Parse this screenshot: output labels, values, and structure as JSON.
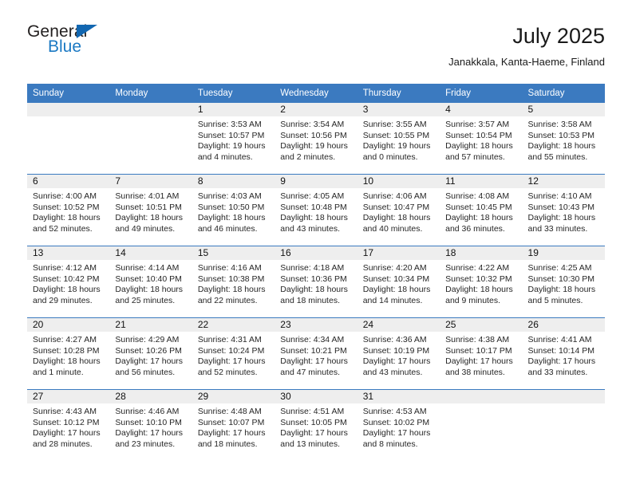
{
  "brand": {
    "word_one": "General",
    "word_two": "Blue",
    "accent_color": "#1b79c3",
    "flag_color": "#1267b1"
  },
  "header": {
    "title": "July 2025",
    "subtitle": "Janakkala, Kanta-Haeme, Finland"
  },
  "theme": {
    "header_blue": "#3b7ac0",
    "daynum_band": "#eeeeee"
  },
  "weekday_headers": [
    "Sunday",
    "Monday",
    "Tuesday",
    "Wednesday",
    "Thursday",
    "Friday",
    "Saturday"
  ],
  "labels": {
    "sunrise_prefix": "Sunrise:",
    "sunset_prefix": "Sunset:",
    "daylight_prefix": "Daylight:"
  },
  "weeks": [
    [
      {
        "day": ""
      },
      {
        "day": ""
      },
      {
        "day": "1",
        "sunrise": "Sunrise: 3:53 AM",
        "sunset": "Sunset: 10:57 PM",
        "daylight": "Daylight: 19 hours and 4 minutes."
      },
      {
        "day": "2",
        "sunrise": "Sunrise: 3:54 AM",
        "sunset": "Sunset: 10:56 PM",
        "daylight": "Daylight: 19 hours and 2 minutes."
      },
      {
        "day": "3",
        "sunrise": "Sunrise: 3:55 AM",
        "sunset": "Sunset: 10:55 PM",
        "daylight": "Daylight: 19 hours and 0 minutes."
      },
      {
        "day": "4",
        "sunrise": "Sunrise: 3:57 AM",
        "sunset": "Sunset: 10:54 PM",
        "daylight": "Daylight: 18 hours and 57 minutes."
      },
      {
        "day": "5",
        "sunrise": "Sunrise: 3:58 AM",
        "sunset": "Sunset: 10:53 PM",
        "daylight": "Daylight: 18 hours and 55 minutes."
      }
    ],
    [
      {
        "day": "6",
        "sunrise": "Sunrise: 4:00 AM",
        "sunset": "Sunset: 10:52 PM",
        "daylight": "Daylight: 18 hours and 52 minutes."
      },
      {
        "day": "7",
        "sunrise": "Sunrise: 4:01 AM",
        "sunset": "Sunset: 10:51 PM",
        "daylight": "Daylight: 18 hours and 49 minutes."
      },
      {
        "day": "8",
        "sunrise": "Sunrise: 4:03 AM",
        "sunset": "Sunset: 10:50 PM",
        "daylight": "Daylight: 18 hours and 46 minutes."
      },
      {
        "day": "9",
        "sunrise": "Sunrise: 4:05 AM",
        "sunset": "Sunset: 10:48 PM",
        "daylight": "Daylight: 18 hours and 43 minutes."
      },
      {
        "day": "10",
        "sunrise": "Sunrise: 4:06 AM",
        "sunset": "Sunset: 10:47 PM",
        "daylight": "Daylight: 18 hours and 40 minutes."
      },
      {
        "day": "11",
        "sunrise": "Sunrise: 4:08 AM",
        "sunset": "Sunset: 10:45 PM",
        "daylight": "Daylight: 18 hours and 36 minutes."
      },
      {
        "day": "12",
        "sunrise": "Sunrise: 4:10 AM",
        "sunset": "Sunset: 10:43 PM",
        "daylight": "Daylight: 18 hours and 33 minutes."
      }
    ],
    [
      {
        "day": "13",
        "sunrise": "Sunrise: 4:12 AM",
        "sunset": "Sunset: 10:42 PM",
        "daylight": "Daylight: 18 hours and 29 minutes."
      },
      {
        "day": "14",
        "sunrise": "Sunrise: 4:14 AM",
        "sunset": "Sunset: 10:40 PM",
        "daylight": "Daylight: 18 hours and 25 minutes."
      },
      {
        "day": "15",
        "sunrise": "Sunrise: 4:16 AM",
        "sunset": "Sunset: 10:38 PM",
        "daylight": "Daylight: 18 hours and 22 minutes."
      },
      {
        "day": "16",
        "sunrise": "Sunrise: 4:18 AM",
        "sunset": "Sunset: 10:36 PM",
        "daylight": "Daylight: 18 hours and 18 minutes."
      },
      {
        "day": "17",
        "sunrise": "Sunrise: 4:20 AM",
        "sunset": "Sunset: 10:34 PM",
        "daylight": "Daylight: 18 hours and 14 minutes."
      },
      {
        "day": "18",
        "sunrise": "Sunrise: 4:22 AM",
        "sunset": "Sunset: 10:32 PM",
        "daylight": "Daylight: 18 hours and 9 minutes."
      },
      {
        "day": "19",
        "sunrise": "Sunrise: 4:25 AM",
        "sunset": "Sunset: 10:30 PM",
        "daylight": "Daylight: 18 hours and 5 minutes."
      }
    ],
    [
      {
        "day": "20",
        "sunrise": "Sunrise: 4:27 AM",
        "sunset": "Sunset: 10:28 PM",
        "daylight": "Daylight: 18 hours and 1 minute."
      },
      {
        "day": "21",
        "sunrise": "Sunrise: 4:29 AM",
        "sunset": "Sunset: 10:26 PM",
        "daylight": "Daylight: 17 hours and 56 minutes."
      },
      {
        "day": "22",
        "sunrise": "Sunrise: 4:31 AM",
        "sunset": "Sunset: 10:24 PM",
        "daylight": "Daylight: 17 hours and 52 minutes."
      },
      {
        "day": "23",
        "sunrise": "Sunrise: 4:34 AM",
        "sunset": "Sunset: 10:21 PM",
        "daylight": "Daylight: 17 hours and 47 minutes."
      },
      {
        "day": "24",
        "sunrise": "Sunrise: 4:36 AM",
        "sunset": "Sunset: 10:19 PM",
        "daylight": "Daylight: 17 hours and 43 minutes."
      },
      {
        "day": "25",
        "sunrise": "Sunrise: 4:38 AM",
        "sunset": "Sunset: 10:17 PM",
        "daylight": "Daylight: 17 hours and 38 minutes."
      },
      {
        "day": "26",
        "sunrise": "Sunrise: 4:41 AM",
        "sunset": "Sunset: 10:14 PM",
        "daylight": "Daylight: 17 hours and 33 minutes."
      }
    ],
    [
      {
        "day": "27",
        "sunrise": "Sunrise: 4:43 AM",
        "sunset": "Sunset: 10:12 PM",
        "daylight": "Daylight: 17 hours and 28 minutes."
      },
      {
        "day": "28",
        "sunrise": "Sunrise: 4:46 AM",
        "sunset": "Sunset: 10:10 PM",
        "daylight": "Daylight: 17 hours and 23 minutes."
      },
      {
        "day": "29",
        "sunrise": "Sunrise: 4:48 AM",
        "sunset": "Sunset: 10:07 PM",
        "daylight": "Daylight: 17 hours and 18 minutes."
      },
      {
        "day": "30",
        "sunrise": "Sunrise: 4:51 AM",
        "sunset": "Sunset: 10:05 PM",
        "daylight": "Daylight: 17 hours and 13 minutes."
      },
      {
        "day": "31",
        "sunrise": "Sunrise: 4:53 AM",
        "sunset": "Sunset: 10:02 PM",
        "daylight": "Daylight: 17 hours and 8 minutes."
      },
      {
        "day": ""
      },
      {
        "day": ""
      }
    ]
  ]
}
